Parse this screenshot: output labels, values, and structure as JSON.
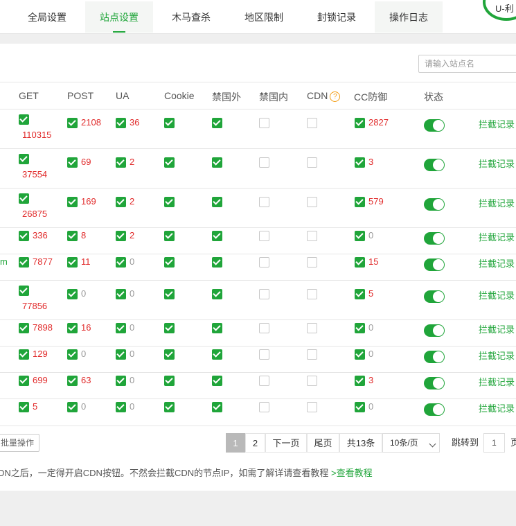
{
  "tabs": [
    {
      "label": "全局设置"
    },
    {
      "label": "站点设置"
    },
    {
      "label": "木马查杀"
    },
    {
      "label": "地区限制"
    },
    {
      "label": "封锁记录"
    },
    {
      "label": "操作日志"
    }
  ],
  "corner_badge": "U-利",
  "search": {
    "placeholder": "请输入站点名"
  },
  "columns": {
    "get": "GET",
    "post": "POST",
    "ua": "UA",
    "cookie": "Cookie",
    "foreign": "禁国外",
    "domestic": "禁国内",
    "cdn": "CDN",
    "cdn_help": "?",
    "cc": "CC防御",
    "status": "状态"
  },
  "rows": [
    {
      "site": "",
      "get": "110315",
      "post": "2108",
      "ua": "36",
      "cookie": true,
      "foreign": true,
      "domestic": false,
      "cdn": false,
      "cc": "2827",
      "status": true,
      "action": "拦截记录"
    },
    {
      "site": "",
      "get": "37554",
      "post": "69",
      "ua": "2",
      "cookie": true,
      "foreign": true,
      "domestic": false,
      "cdn": false,
      "cc": "3",
      "status": true,
      "action": "拦截记录"
    },
    {
      "site": "",
      "get": "26875",
      "post": "169",
      "ua": "2",
      "cookie": true,
      "foreign": true,
      "domestic": false,
      "cdn": false,
      "cc": "579",
      "status": true,
      "action": "拦截记录"
    },
    {
      "site": "",
      "get": "336",
      "post": "8",
      "ua": "2",
      "cookie": true,
      "foreign": true,
      "domestic": false,
      "cdn": false,
      "cc": "0",
      "status": true,
      "action": "拦截记录"
    },
    {
      "site": "m",
      "get": "7877",
      "post": "11",
      "ua": "0",
      "cookie": true,
      "foreign": true,
      "domestic": false,
      "cdn": false,
      "cc": "15",
      "status": true,
      "action": "拦截记录"
    },
    {
      "site": "",
      "get": "77856",
      "post": "0",
      "ua": "0",
      "cookie": true,
      "foreign": true,
      "domestic": false,
      "cdn": false,
      "cc": "5",
      "status": true,
      "action": "拦截记录"
    },
    {
      "site": "",
      "get": "7898",
      "post": "16",
      "ua": "0",
      "cookie": true,
      "foreign": true,
      "domestic": false,
      "cdn": false,
      "cc": "0",
      "status": true,
      "action": "拦截记录"
    },
    {
      "site": "",
      "get": "129",
      "post": "0",
      "ua": "0",
      "cookie": true,
      "foreign": true,
      "domestic": false,
      "cdn": false,
      "cc": "0",
      "status": true,
      "action": "拦截记录"
    },
    {
      "site": "",
      "get": "699",
      "post": "63",
      "ua": "0",
      "cookie": true,
      "foreign": true,
      "domestic": false,
      "cdn": false,
      "cc": "3",
      "status": true,
      "action": "拦截记录"
    },
    {
      "site": "",
      "get": "5",
      "post": "0",
      "ua": "0",
      "cookie": true,
      "foreign": true,
      "domestic": false,
      "cdn": false,
      "cc": "0",
      "status": true,
      "action": "拦截记录"
    }
  ],
  "footer": {
    "batch_label": "批量操作",
    "pages": [
      "1",
      "2"
    ],
    "next_label": "下一页",
    "last_label": "尾页",
    "total_label": "共13条",
    "per_page": "10条/页",
    "jump_label": "跳转到",
    "jump_value": "1",
    "page_unit": "页"
  },
  "note": {
    "text": "DN之后，一定得开启CDN按钮。不然会拦截CDN的节点IP，如需了解详请查看教程 ",
    "link": ">查看教程"
  },
  "colors": {
    "accent": "#20a53a",
    "danger": "#e12b2b"
  }
}
